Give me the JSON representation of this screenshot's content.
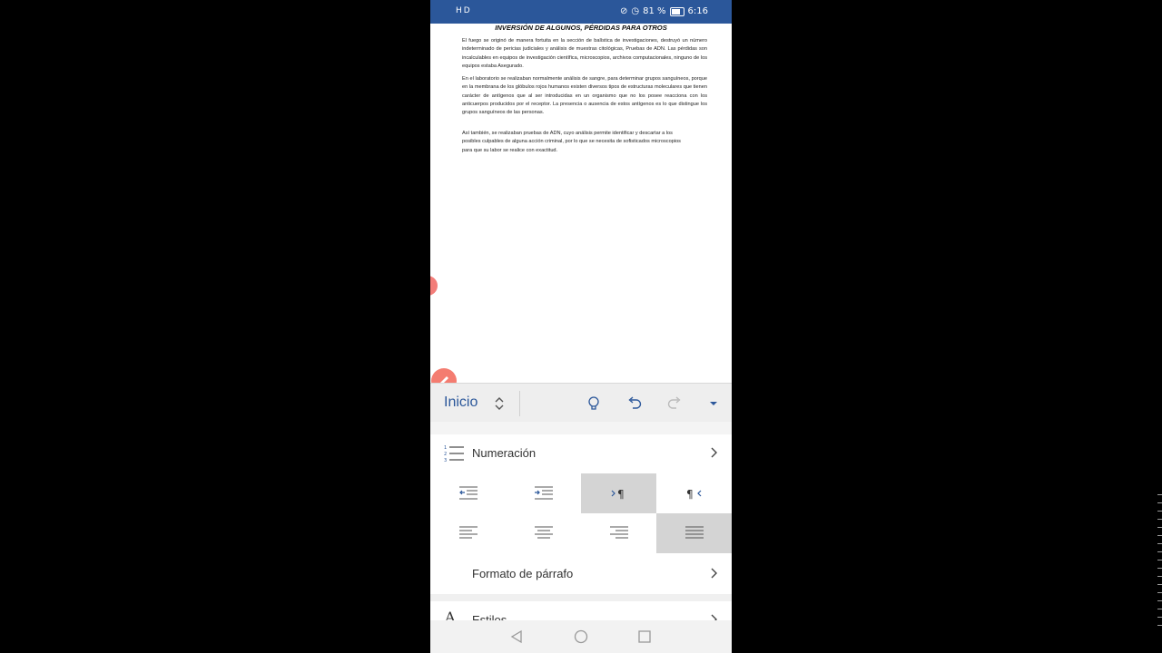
{
  "status_bar": {
    "left_icons": "HD",
    "battery": "81 %",
    "time": "6:16"
  },
  "document": {
    "title": "INVERSIÓN DE ALGUNOS, PÉRDIDAS PARA OTROS",
    "paragraphs": [
      "El fuego se originó de manera fortuita en la sección de balística de investigaciones, destruyó un número indeterminado de pericias judiciales y análisis de muestras citológicas, Pruebas de ADN. Las pérdidas son incalculables en equipos de investigación científica, microscopios, archivos computacionales, ninguno de los equipos estaba Asegurado.",
      "En el laboratorio se realizaban normalmente análisis de sangre, para determinar grupos sanguíneos, porque en la membrana de los glóbulos rojos humanos existen diversos tipos de estructuras moleculares que tienen carácter de antígenos que al ser introducidas en un organismo que no los posee reacciona con los anticuerpos producidos por el receptor. La presencia o ausencia de estos antígenos es lo que distingue los grupos sanguíneos de las personas.",
      "Así también, se realizaban pruebas de ADN, cuyo análisis permite identificar y descartar a los posibles culpables de alguna acción criminal, por lo que se necesita de sofisticados microscopios para que su labor se realice con exactitud."
    ]
  },
  "ribbon": {
    "tab_label": "Inicio"
  },
  "panel": {
    "numeracion_label": "Numeración",
    "formato_label": "Formato de párrafo",
    "estilos_label": "Estilos",
    "estilos_icon_glyph": "A"
  },
  "colors": {
    "accent": "#2b579a",
    "selected_cell": "#d4d4d4",
    "pen_button": "#f47c70"
  }
}
